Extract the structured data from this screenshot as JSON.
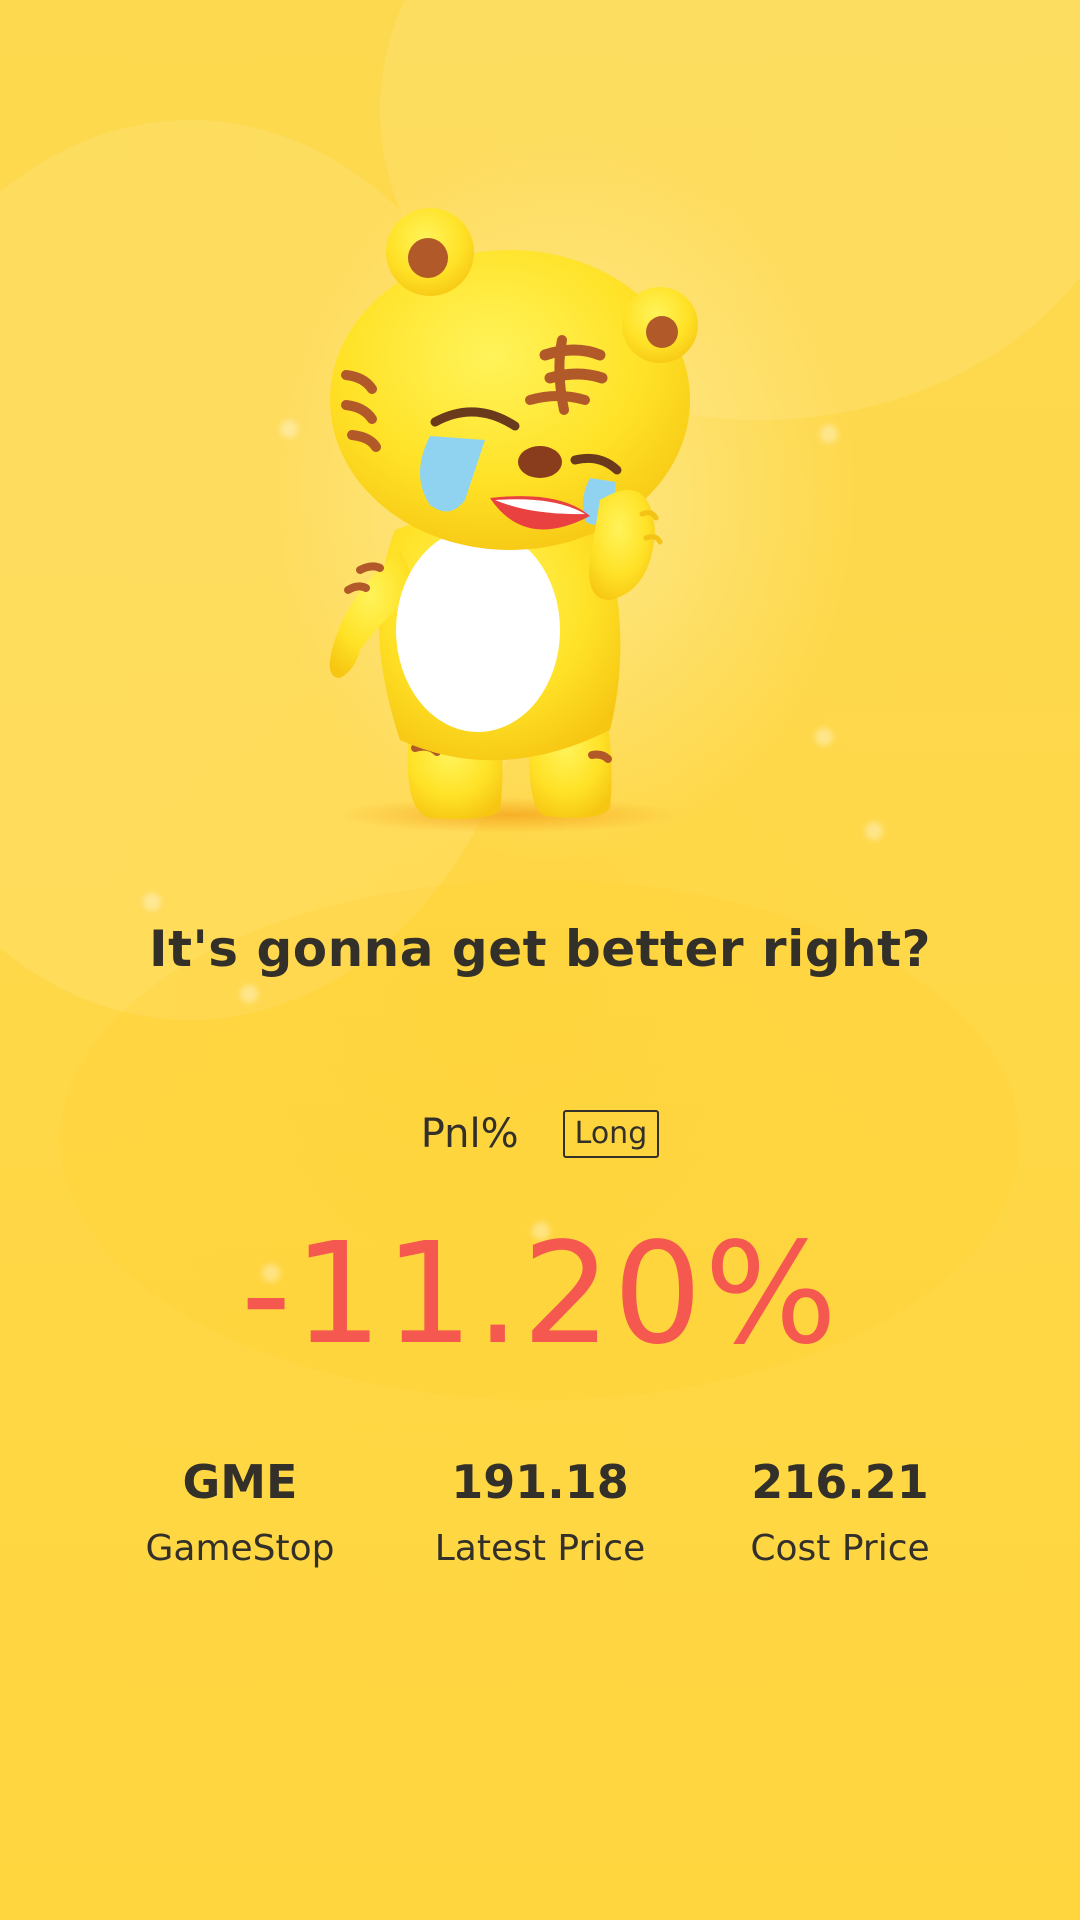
{
  "headline": "It's gonna get better right?",
  "pnl": {
    "label": "Pnl%",
    "direction": "Long",
    "value": "-11.20%"
  },
  "stats": [
    {
      "value": "GME",
      "label": "GameStop"
    },
    {
      "value": "191.18",
      "label": "Latest Price"
    },
    {
      "value": "216.21",
      "label": "Cost Price"
    }
  ],
  "mascot": {
    "icon": "crying-tiger-mascot-icon"
  },
  "colors": {
    "background": "#ffd84a",
    "text": "#33302a",
    "loss": "#f5584e"
  }
}
